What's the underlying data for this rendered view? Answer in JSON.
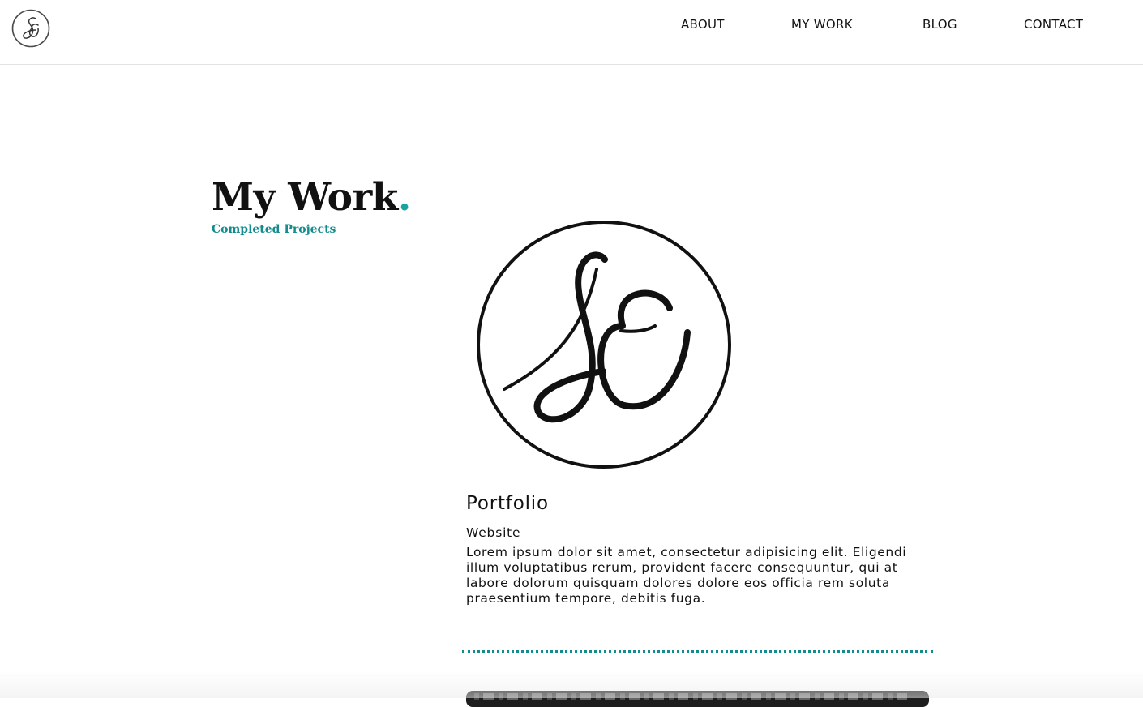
{
  "nav": {
    "logo_icon": "se-monogram-logo",
    "links": [
      {
        "label": "ABOUT"
      },
      {
        "label": "MY WORK"
      },
      {
        "label": "BLOG"
      },
      {
        "label": "CONTACT"
      }
    ]
  },
  "heading": {
    "title": "My Work",
    "title_punctuation": ".",
    "subtitle": "Completed Projects"
  },
  "projects": [
    {
      "image_icon": "se-monogram-logo",
      "title": "Portfolio",
      "type": "Website",
      "description": "Lorem ipsum dolor sit amet, consectetur adipisicing elit. Eligendi illum voluptatibus rerum, provident facere consequuntur, qui at labore dolorum quisquam dolores dolore eos officia rem soluta praesentium tempore, debitis fuga."
    }
  ],
  "colors": {
    "accent": "#128c8c",
    "title_dot": "#1aa3a3",
    "text": "#111111",
    "nav_border": "#e2e2e2"
  }
}
